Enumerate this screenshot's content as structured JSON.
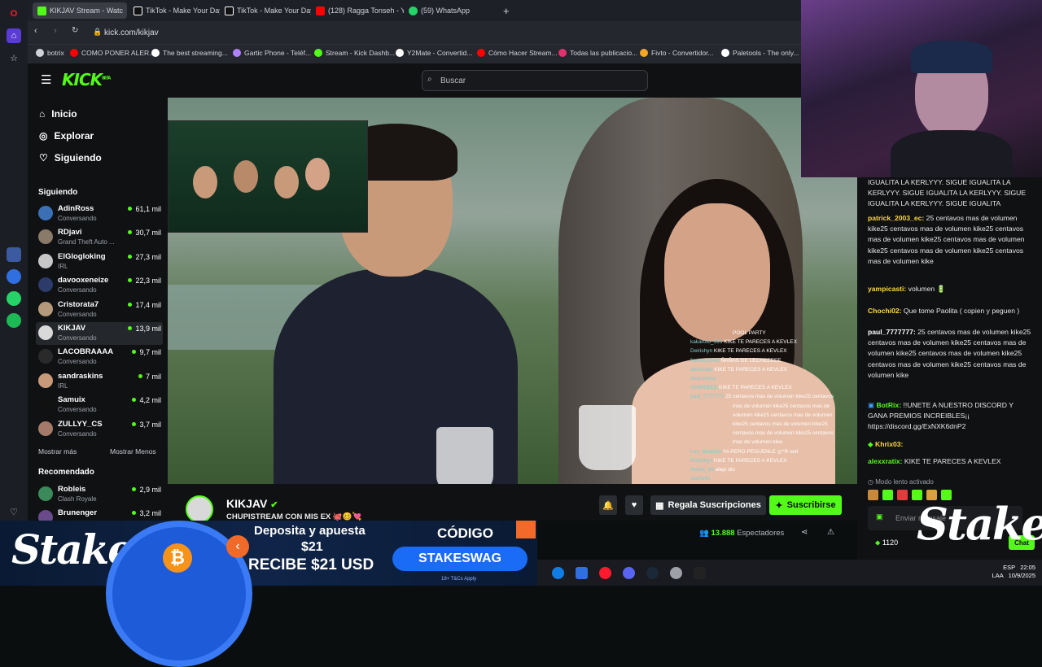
{
  "browser": {
    "tabs": [
      {
        "label": "KIKJAV Stream - Watc",
        "color": "#53fc18"
      },
      {
        "label": "TikTok - Make Your Day",
        "color": "#ffffff"
      },
      {
        "label": "TikTok - Make Your Day",
        "color": "#ffffff"
      },
      {
        "label": "(128) Ragga Tonseh - You",
        "color": "#ff0000"
      },
      {
        "label": "(59) WhatsApp",
        "color": "#25d366"
      }
    ],
    "new_tab": "+",
    "url": "kick.com/kikjav",
    "bookmarks": [
      {
        "label": "botrix",
        "color": "#cfd2d8"
      },
      {
        "label": "COMO PONER ALER...",
        "color": "#ff0000"
      },
      {
        "label": "The best streaming...",
        "color": "#ffffff"
      },
      {
        "label": "Gartic Phone - Teléf...",
        "color": "#b080ff"
      },
      {
        "label": "Stream - Kick Dashb...",
        "color": "#53fc18"
      },
      {
        "label": "Y2Mate - Convertid...",
        "color": "#ffffff"
      },
      {
        "label": "Cómo Hacer Stream...",
        "color": "#ff0000"
      },
      {
        "label": "Todas las publicacio...",
        "color": "#e1306c"
      },
      {
        "label": "Fivto - Convertidor...",
        "color": "#f5a623"
      },
      {
        "label": "Paletools - The only...",
        "color": "#ffffff"
      }
    ]
  },
  "kick": {
    "logo": "KICK",
    "logo_beta": "BETA",
    "search_placeholder": "Buscar",
    "nav": [
      {
        "label": "Inicio",
        "icon": "home-icon"
      },
      {
        "label": "Explorar",
        "icon": "compass-icon"
      },
      {
        "label": "Siguiendo",
        "icon": "heart-icon"
      }
    ],
    "following_title": "Siguiendo",
    "following": [
      {
        "name": "AdinRoss",
        "sub": "Conversando",
        "viewers": "61,1 mil",
        "color": "#3b6fb6"
      },
      {
        "name": "RDjavi",
        "sub": "Grand Theft Auto ...",
        "viewers": "30,7 mil",
        "color": "#8a7a6a"
      },
      {
        "name": "ElGlogloking",
        "sub": "IRL",
        "viewers": "27,3 mil",
        "color": "#c7c7c7"
      },
      {
        "name": "davooxeneize",
        "sub": "Conversando",
        "viewers": "22,3 mil",
        "color": "#2d3b6a"
      },
      {
        "name": "Cristorata7",
        "sub": "Conversando",
        "viewers": "17,4 mil",
        "color": "#b49a7a"
      },
      {
        "name": "KIKJAV",
        "sub": "Conversando",
        "viewers": "13,9 mil",
        "color": "#d9d9d9"
      },
      {
        "name": "LACOBRAAAA",
        "sub": "Conversando",
        "viewers": "9,7 mil",
        "color": "#2a2a2a"
      },
      {
        "name": "sandraskins",
        "sub": "IRL",
        "viewers": "7 mil",
        "color": "#c99a7a"
      },
      {
        "name": "Samuix",
        "sub": "Conversando",
        "viewers": "4,2 mil",
        "color": "#111111"
      },
      {
        "name": "ZULLYY_CS",
        "sub": "Conversando",
        "viewers": "3,7 mil",
        "color": "#a57a6a"
      }
    ],
    "show_more": "Mostrar más",
    "show_less": "Mostrar Menos",
    "recommended_title": "Recomendado",
    "recommended": [
      {
        "name": "Robleis",
        "sub": "Clash Royale",
        "viewers": "2,9 mil",
        "color": "#3a8a5a"
      },
      {
        "name": "Brunenger",
        "sub": "",
        "viewers": "3,2 mil",
        "color": "#6a4a8a"
      }
    ]
  },
  "video_overlay_chat": [
    {
      "user": "",
      "text": "POOL PARTY"
    },
    {
      "user": "kakaroto_593",
      "text": "KIKE TE PARECES A KEVLEX"
    },
    {
      "user": "Deirishyn",
      "text": "KIKE TE PARECES A KEVLEX"
    },
    {
      "user": "frankey2940",
      "text": "ÑAÑAS DE LECHEEEEE"
    },
    {
      "user": "alexxratix",
      "text": "KIKE TE PARECES A KEVLEX"
    },
    {
      "user": "angcarrera",
      "text": ""
    },
    {
      "user": "GABRIEEE",
      "text": "KIKE TE PARECES A KEVLEX"
    },
    {
      "user": "paul_7777777",
      "text": "25 centavos mas de volumen kike25 centavos"
    },
    {
      "user": "",
      "text": "mas de volumen kike25 centavos mas de"
    },
    {
      "user": "",
      "text": "volumen kike25 centavos mas de volumen"
    },
    {
      "user": "",
      "text": "kike25 centavos mas de volumen kike25"
    },
    {
      "user": "",
      "text": "centavos mas de volumen kike25 centavos"
    },
    {
      "user": "",
      "text": "mas de volumen kike"
    },
    {
      "user": "Leo_Bautista",
      "text": "YA PERO PEGUENLE ◎^R ved"
    },
    {
      "user": "Deirishyn",
      "text": "KIKE TE PARECES A KEVLEX"
    },
    {
      "user": "Amiris_16",
      "text": "alajo dio"
    },
    {
      "user": "cachetin",
      "text": ""
    }
  ],
  "channel": {
    "name": "KIKJAV",
    "title": "CHUPISTREAM CON MIS EX 🐙🥴💘",
    "gift_label": "Regala Suscripciones",
    "subscribe_label": "Suscribirse",
    "viewers": "13.888",
    "viewers_label": "Espectadores"
  },
  "chat": {
    "messages": [
      {
        "user": "",
        "color": "#ffffff",
        "text": "IGUALITA LA KERLYYY. SIGUE IGUALITA LA KERLYYY. SIGUE IGUALITA LA KERLYYY. SIGUE IGUALITA LA KERLYYY. SIGUE IGUALITA"
      },
      {
        "user": "patrick_2003_ec:",
        "color": "#ffd93b",
        "text": " 25 centavos mas de volumen kike25 centavos mas de volumen kike25 centavos mas de volumen kike25 centavos mas de volumen kike25 centavos mas de volumen kike25 centavos mas de volumen kike"
      },
      {
        "user": "yampicasti:",
        "color": "#ffd93b",
        "text": " volumen 🔋"
      },
      {
        "user": "Chochi02:",
        "color": "#ffd93b",
        "text": " Que tome Paolita ( copien y peguen )"
      },
      {
        "user": "paul_7777777:",
        "color": "#ffffff",
        "text": " 25 centavos mas de volumen kike25 centavos mas de volumen kike25 centavos mas de volumen kike25 centavos mas de volumen kike25 centavos mas de volumen kike25 centavos mas de volumen kike"
      },
      {
        "user": "BotRix:",
        "color": "#53fc18",
        "text": " !!UNETE A NUESTRO DISCORD Y GANA PREMIOS INCREIBLES¡¡ https://discord.gg/ExNXK6dnP2"
      },
      {
        "user": "Khrix03:",
        "color": "#ffd93b",
        "text": ""
      },
      {
        "user": "alexxratix:",
        "color": "#53fc18",
        "text": " KIKE TE PARECES A KEVLEX"
      }
    ],
    "slow_mode": "Modo lento activado",
    "input_placeholder": "Enviar mensaje",
    "points": "1120",
    "send_label": "Chat"
  },
  "ad": {
    "brand": "Stake",
    "line1": "Deposita y apuesta",
    "amount": "$21",
    "line2": "RECIBE $21 USD",
    "code_title": "CÓDIGO",
    "code": "STAKESWAG",
    "disclaimer": "18+ T&Cs Apply"
  },
  "stake_watermark": "Stake",
  "taskbar": {
    "lang1": "ESP",
    "lang2": "LAA",
    "time": "22:05",
    "date": "10/9/2025"
  }
}
